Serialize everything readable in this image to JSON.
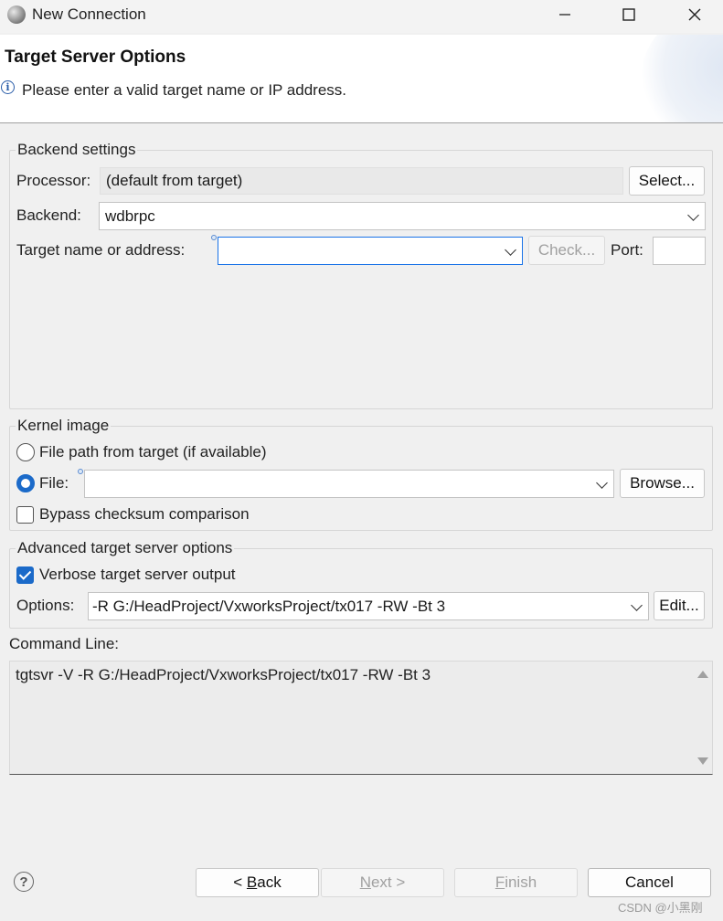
{
  "window": {
    "title": "New Connection",
    "minimize_icon": "minimize-icon",
    "maximize_icon": "maximize-icon",
    "close_icon": "close-icon"
  },
  "header": {
    "title": "Target Server Options",
    "message": "Please enter a valid target name or IP address.",
    "info_icon": "i"
  },
  "backend_settings": {
    "legend": "Backend settings",
    "processor_label": "Processor:",
    "processor_value": "(default from target)",
    "select_button": "Select...",
    "backend_label": "Backend:",
    "backend_value": "wdbrpc",
    "target_label": "Target name or address:",
    "target_value": "",
    "check_button": "Check...",
    "port_label": "Port:",
    "port_value": ""
  },
  "kernel_image": {
    "legend": "Kernel image",
    "radio_from_target": "File path from target (if available)",
    "radio_file": "File:",
    "file_value": "",
    "browse_button": "Browse...",
    "bypass_label": "Bypass checksum comparison"
  },
  "advanced": {
    "legend": "Advanced target server options",
    "verbose_label": "Verbose target server output",
    "options_label": "Options:",
    "options_value": "-R G:/HeadProject/VxworksProject/tx017 -RW -Bt 3",
    "edit_button": "Edit..."
  },
  "command_line": {
    "label": "Command Line:",
    "value": "tgtsvr -V -R G:/HeadProject/VxworksProject/tx017 -RW -Bt 3"
  },
  "footer": {
    "help_icon": "?",
    "back_prefix": "< ",
    "back_key": "B",
    "back_rest": "ack",
    "next_key": "N",
    "next_rest": "ext >",
    "finish_key": "F",
    "finish_rest": "inish",
    "cancel_label": "Cancel"
  },
  "watermark": "CSDN @小黑刚",
  "colors": {
    "accent": "#1b6ac9",
    "focus_border": "#1a73e8"
  }
}
